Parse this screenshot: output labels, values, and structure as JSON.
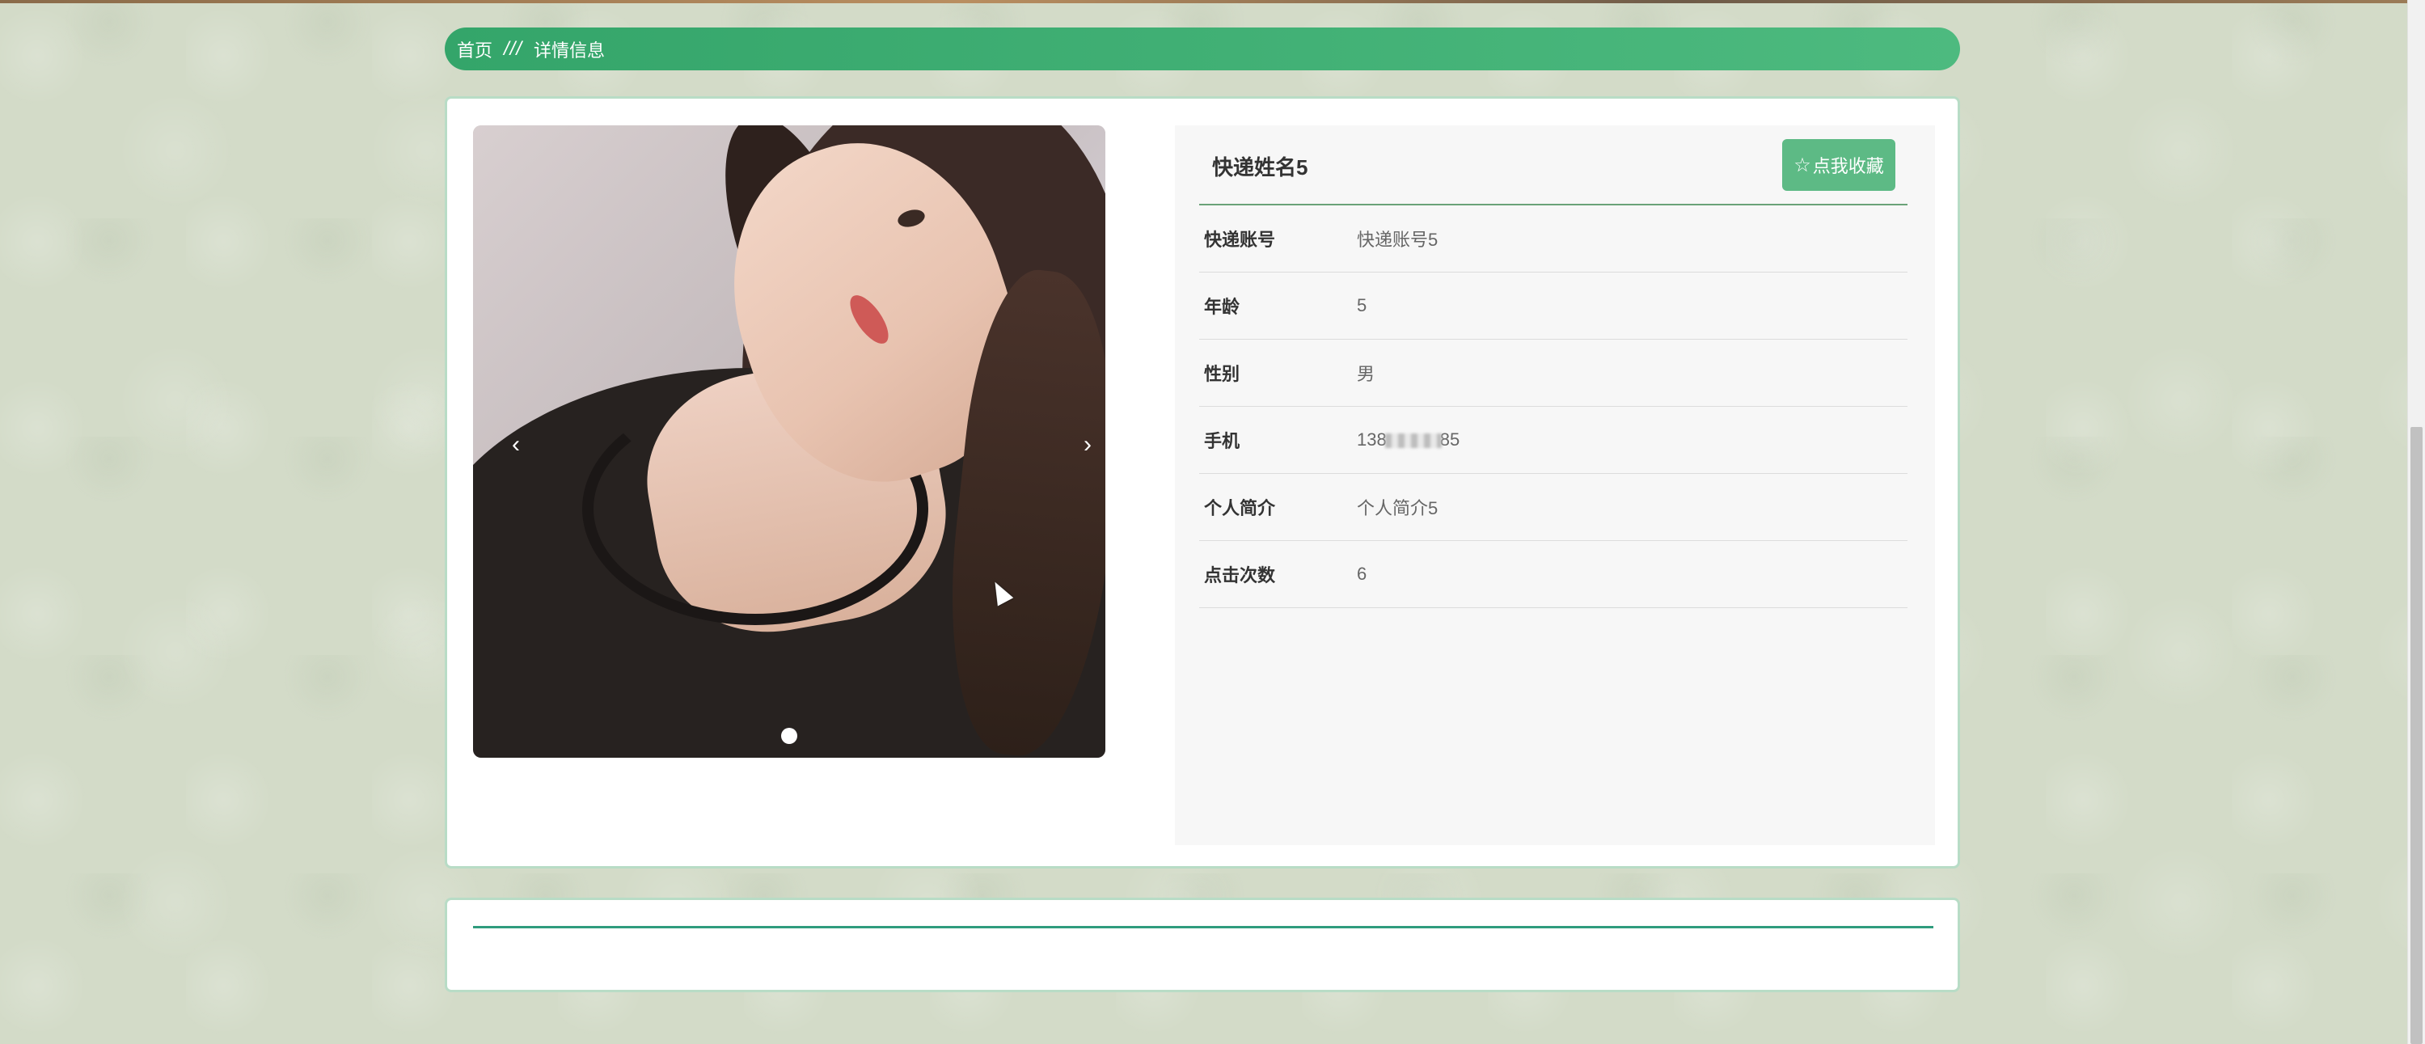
{
  "breadcrumb": {
    "home": "首页",
    "separator": "///",
    "current": "详情信息"
  },
  "carousel": {
    "prev_glyph": "‹",
    "next_glyph": "›",
    "slide_count": 1,
    "active_slide": 1
  },
  "detail": {
    "title": "快递姓名5",
    "favorite_button": "点我收藏",
    "favorite_icon": "star-outline-icon",
    "fields": [
      {
        "label": "快递账号",
        "value": "快递账号5"
      },
      {
        "label": "年龄",
        "value": "5"
      },
      {
        "label": "性别",
        "value": "男"
      },
      {
        "label": "手机",
        "value_prefix": "138",
        "value_suffix": "85"
      },
      {
        "label": "个人简介",
        "value": "个人简介5"
      },
      {
        "label": "点击次数",
        "value": "6"
      }
    ]
  },
  "colors": {
    "accent_green": "#3aa86f",
    "button_green": "#5dba85",
    "card_border": "#b8dcc6",
    "divider_teal": "#2f9c7d"
  }
}
